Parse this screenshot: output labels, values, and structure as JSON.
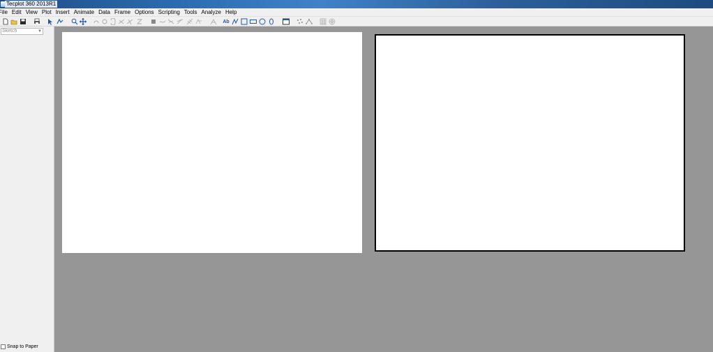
{
  "window": {
    "title": "Tecplot 360 2013R1"
  },
  "menu": [
    "File",
    "Edit",
    "View",
    "Plot",
    "Insert",
    "Animate",
    "Data",
    "Frame",
    "Options",
    "Scripting",
    "Tools",
    "Analyze",
    "Help"
  ],
  "sidebar": {
    "mode_select": "Sketch",
    "snap_label": "Snap to Paper"
  },
  "toolbar": {
    "text_tool_label": "Ab"
  },
  "colors": {
    "workspace": "#969696",
    "chrome": "#f0f0f0",
    "titlebar": "#2b6cb0",
    "icon_blue": "#1f57a8"
  }
}
